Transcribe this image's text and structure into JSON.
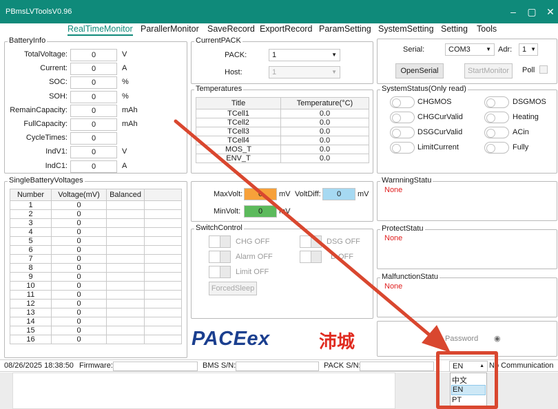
{
  "window": {
    "title": "PBmsLVToolsV0.96",
    "minimize": "–",
    "maximize": "▢",
    "close": "✕"
  },
  "menu": [
    "RealTimeMonitor",
    "ParallerMonitor",
    "SaveRecord",
    "ExportRecord",
    "ParamSetting",
    "SystemSetting",
    "Setting",
    "Tools"
  ],
  "batteryInfo": {
    "title": "BatteryInfo",
    "rows": [
      {
        "label": "TotalVoltage:",
        "value": "0",
        "unit": "V"
      },
      {
        "label": "Current:",
        "value": "0",
        "unit": "A"
      },
      {
        "label": "SOC:",
        "value": "0",
        "unit": "%"
      },
      {
        "label": "SOH:",
        "value": "0",
        "unit": "%"
      },
      {
        "label": "RemainCapacity:",
        "value": "0",
        "unit": "mAh"
      },
      {
        "label": "FullCapacity:",
        "value": "0",
        "unit": "mAh"
      },
      {
        "label": "CycleTimes:",
        "value": "0",
        "unit": ""
      },
      {
        "label": "IndV1:",
        "value": "0",
        "unit": "V"
      },
      {
        "label": "IndC1:",
        "value": "0",
        "unit": "A"
      }
    ]
  },
  "currentPack": {
    "title": "CurrentPACK",
    "packLabel": "PACK:",
    "packValue": "1",
    "hostLabel": "Host:",
    "hostValue": "1"
  },
  "serial": {
    "serialLabel": "Serial:",
    "port": "COM3",
    "adrLabel": "Adr:",
    "adr": "1",
    "openBtn": "OpenSerial",
    "startBtn": "StartMonitor",
    "pollLabel": "Poll"
  },
  "temperatures": {
    "title": "Temperatures",
    "headers": [
      "Title",
      "Temperature(°C)"
    ],
    "rows": [
      [
        "TCell1",
        "0.0"
      ],
      [
        "TCell2",
        "0.0"
      ],
      [
        "TCell3",
        "0.0"
      ],
      [
        "TCell4",
        "0.0"
      ],
      [
        "MOS_T",
        "0.0"
      ],
      [
        "ENV_T",
        "0.0"
      ]
    ]
  },
  "systemStatus": {
    "title": "SystemStatus(Only read)",
    "left": [
      "CHGMOS",
      "CHGCurValid",
      "DSGCurValid",
      "LimitCurrent"
    ],
    "right": [
      "DSGMOS",
      "Heating",
      "ACin",
      "Fully"
    ]
  },
  "singleVoltages": {
    "title": "SingleBatteryVoltages",
    "headers": [
      "Number",
      "Voltage(mV)",
      "Balanced",
      ""
    ],
    "rows": [
      [
        "1",
        "0"
      ],
      [
        "2",
        "0"
      ],
      [
        "3",
        "0"
      ],
      [
        "4",
        "0"
      ],
      [
        "5",
        "0"
      ],
      [
        "6",
        "0"
      ],
      [
        "7",
        "0"
      ],
      [
        "8",
        "0"
      ],
      [
        "9",
        "0"
      ],
      [
        "10",
        "0"
      ],
      [
        "11",
        "0"
      ],
      [
        "12",
        "0"
      ],
      [
        "13",
        "0"
      ],
      [
        "14",
        "0"
      ],
      [
        "15",
        "0"
      ],
      [
        "16",
        "0"
      ]
    ]
  },
  "voltSummary": {
    "maxLabel": "MaxVolt:",
    "maxValue": "0",
    "maxUnit": "mV",
    "diffLabel": "VoltDiff:",
    "diffValue": "0",
    "diffUnit": "mV",
    "minLabel": "MinVolt:",
    "minValue": "0",
    "minUnit": "mV",
    "maxColor": "#f7a13a",
    "diffColor": "#a6d9f2",
    "minColor": "#5cba5c"
  },
  "switchControl": {
    "title": "SwitchControl",
    "chg": "CHG OFF",
    "dsg": "DSG OFF",
    "alarm": "Alarm OFF",
    "d": "D OFF",
    "limit": "Limit OFF",
    "forcedSleep": "ForcedSleep"
  },
  "warning": {
    "title": "WarnningStatu",
    "text": "None"
  },
  "protect": {
    "title": "ProtectStatu",
    "text": "None"
  },
  "malfunction": {
    "title": "MalfunctionStatu",
    "text": "None"
  },
  "logo": {
    "brand": "PACEex",
    "cn": "沛城",
    "brandColor": "#1b3f8f",
    "cnColor": "#e02b20"
  },
  "password": {
    "placeholder": "Password"
  },
  "status": {
    "datetime": "08/26/2025 18:38:50",
    "firmware": "Firmware:",
    "bmsSn": "BMS S/N:",
    "packSn": "PACK S/N:",
    "lang": "EN",
    "comm": "No Communication"
  },
  "langMenu": [
    "中文",
    "EN",
    "PT"
  ],
  "accent": "#0f8a7a"
}
